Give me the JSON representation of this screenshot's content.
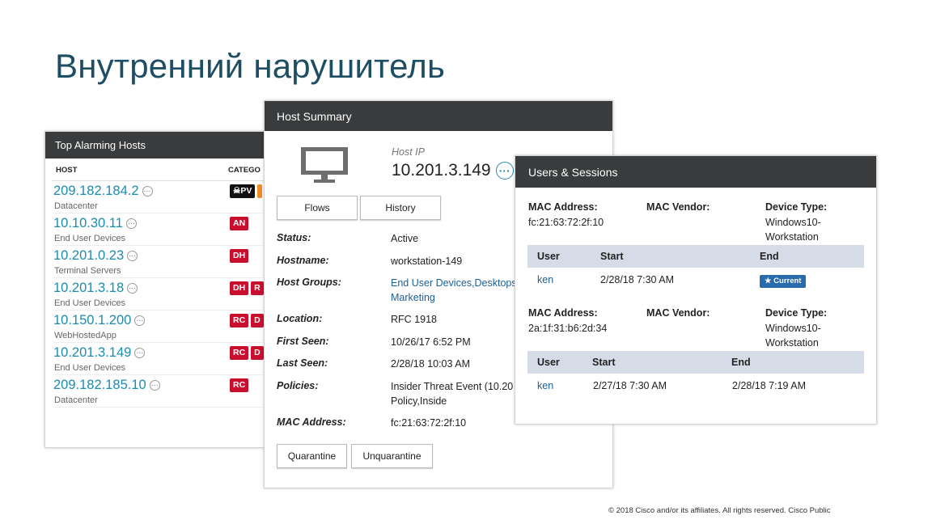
{
  "slide": {
    "title": "Внутренний нарушитель",
    "footer": "© 2018  Cisco and/or its affiliates. All rights reserved.   Cisco Public"
  },
  "alarm_panel": {
    "title": "Top Alarming Hosts",
    "columns": [
      "HOST",
      "CATEGO"
    ],
    "rows": [
      {
        "ip": "209.182.184.2",
        "group": "Datacenter",
        "badges": [
          "PV",
          ""
        ]
      },
      {
        "ip": "10.10.30.11",
        "group": "End User Devices",
        "badges": [
          "AN"
        ]
      },
      {
        "ip": "10.201.0.23",
        "group": "Terminal Servers",
        "badges": [
          "DH"
        ]
      },
      {
        "ip": "10.201.3.18",
        "group": "End User Devices",
        "badges": [
          "DH",
          "R"
        ]
      },
      {
        "ip": "10.150.1.200",
        "group": "WebHostedApp",
        "badges": [
          "RC",
          "D"
        ]
      },
      {
        "ip": "10.201.3.149",
        "group": "End User Devices",
        "badges": [
          "RC",
          "D"
        ]
      },
      {
        "ip": "209.182.185.10",
        "group": "Datacenter",
        "badges": [
          "RC"
        ]
      }
    ],
    "dots": "···"
  },
  "host_panel": {
    "title": "Host Summary",
    "ip_label": "Host IP",
    "ip": "10.201.3.149",
    "dots": "···",
    "tabs": {
      "flows": "Flows",
      "history": "History"
    },
    "fields": [
      {
        "label": "Status:",
        "value": "Active"
      },
      {
        "label": "Hostname:",
        "value": "workstation-149"
      },
      {
        "label": "Host Groups:",
        "value_line1": "End User Devices,Desktops",
        "value_line2": "Marketing"
      },
      {
        "label": "Location:",
        "value": "RFC 1918"
      },
      {
        "label": "First Seen:",
        "value": "10/26/17 6:52 PM"
      },
      {
        "label": "Last Seen:",
        "value": "2/28/18 10:03 AM"
      },
      {
        "label": "Policies:",
        "value_line1": "Insider Threat Event (10.20",
        "value_line2": "Policy,Inside"
      },
      {
        "label": "MAC Address:",
        "value": "fc:21:63:72:2f:10"
      }
    ],
    "buttons": {
      "quarantine": "Quarantine",
      "unquarantine": "Unquarantine"
    }
  },
  "users_panel": {
    "title": "Users & Sessions",
    "labels": {
      "mac": "MAC Address:",
      "vendor": "MAC Vendor:",
      "device": "Device Type:"
    },
    "sessions": [
      {
        "mac": "fc:21:63:72:2f:10",
        "device_line1": "Windows10-",
        "device_line2": "Workstation",
        "headers": [
          "User",
          "Start",
          "End"
        ],
        "user": "ken",
        "start": "2/28/18 7:30 AM",
        "end_badge": "★ Current"
      },
      {
        "mac": "2a:1f:31:b6:2d:34",
        "device_line1": "Windows10-",
        "device_line2": "Workstation",
        "headers": [
          "User",
          "Start",
          "End"
        ],
        "user": "ken",
        "start": "2/27/18 7:30 AM",
        "end": "2/28/18 7:19 AM"
      }
    ]
  },
  "colors": {
    "header_bg": "#393b3c",
    "ip_blue": "#1a8cb0",
    "alert_red": "#c8102e",
    "table_head": "#d5dce8",
    "title_teal": "#1e4e63"
  }
}
